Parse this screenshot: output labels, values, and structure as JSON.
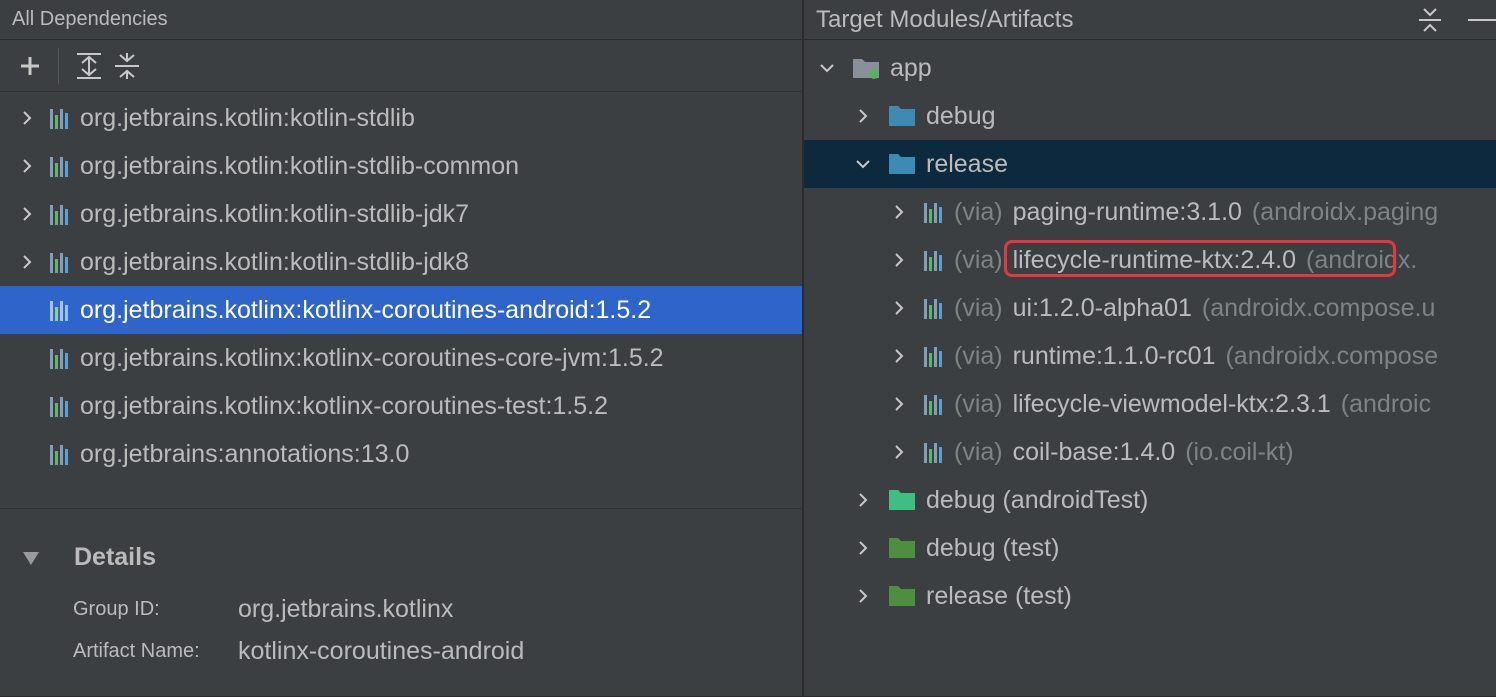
{
  "left_panel": {
    "title": "All Dependencies",
    "toolbar": {
      "add": "+",
      "expand_all": "expand-all-icon",
      "collapse_all": "collapse-all-icon"
    },
    "dependencies": [
      {
        "label": "org.jetbrains.kotlin:kotlin-stdlib",
        "expandable": true,
        "selected": false
      },
      {
        "label": "org.jetbrains.kotlin:kotlin-stdlib-common",
        "expandable": true,
        "selected": false
      },
      {
        "label": "org.jetbrains.kotlin:kotlin-stdlib-jdk7",
        "expandable": true,
        "selected": false
      },
      {
        "label": "org.jetbrains.kotlin:kotlin-stdlib-jdk8",
        "expandable": true,
        "selected": false
      },
      {
        "label": "org.jetbrains.kotlinx:kotlinx-coroutines-android:1.5.2",
        "expandable": false,
        "selected": true
      },
      {
        "label": "org.jetbrains.kotlinx:kotlinx-coroutines-core-jvm:1.5.2",
        "expandable": false,
        "selected": false
      },
      {
        "label": "org.jetbrains.kotlinx:kotlinx-coroutines-test:1.5.2",
        "expandable": false,
        "selected": false
      },
      {
        "label": "org.jetbrains:annotations:13.0",
        "expandable": false,
        "selected": false
      }
    ],
    "details": {
      "title": "Details",
      "group_id_label": "Group ID:",
      "group_id_value": "org.jetbrains.kotlinx",
      "artifact_name_label": "Artifact Name:",
      "artifact_name_value": "kotlinx-coroutines-android"
    }
  },
  "right_panel": {
    "title": "Target Modules/Artifacts",
    "tree": {
      "app": "app",
      "debug": "debug",
      "release": "release",
      "release_children": [
        {
          "via": "(via)",
          "name": "paging-runtime:3.1.0",
          "group": "(androidx.paging"
        },
        {
          "via": "(via)",
          "name": "lifecycle-runtime-ktx:2.4.0",
          "group": "(androidx."
        },
        {
          "via": "(via)",
          "name": "ui:1.2.0-alpha01",
          "group": "(androidx.compose.u"
        },
        {
          "via": "(via)",
          "name": "runtime:1.1.0-rc01",
          "group": "(androidx.compose"
        },
        {
          "via": "(via)",
          "name": "lifecycle-viewmodel-ktx:2.3.1",
          "group": "(androic"
        },
        {
          "via": "(via)",
          "name": "coil-base:1.4.0",
          "group": "(io.coil-kt)"
        }
      ],
      "debug_android_test": "debug (androidTest)",
      "debug_test": "debug (test)",
      "release_test": "release (test)"
    }
  },
  "colors": {
    "panel_bg": "#3c3f41",
    "selection": "#2f65ca",
    "release_row_bg": "#0d293e",
    "highlight_border": "#e0393e",
    "folder_blue": "#3d8ab3",
    "folder_green_bright": "#3fbf7f",
    "folder_green": "#4e8f3f"
  }
}
